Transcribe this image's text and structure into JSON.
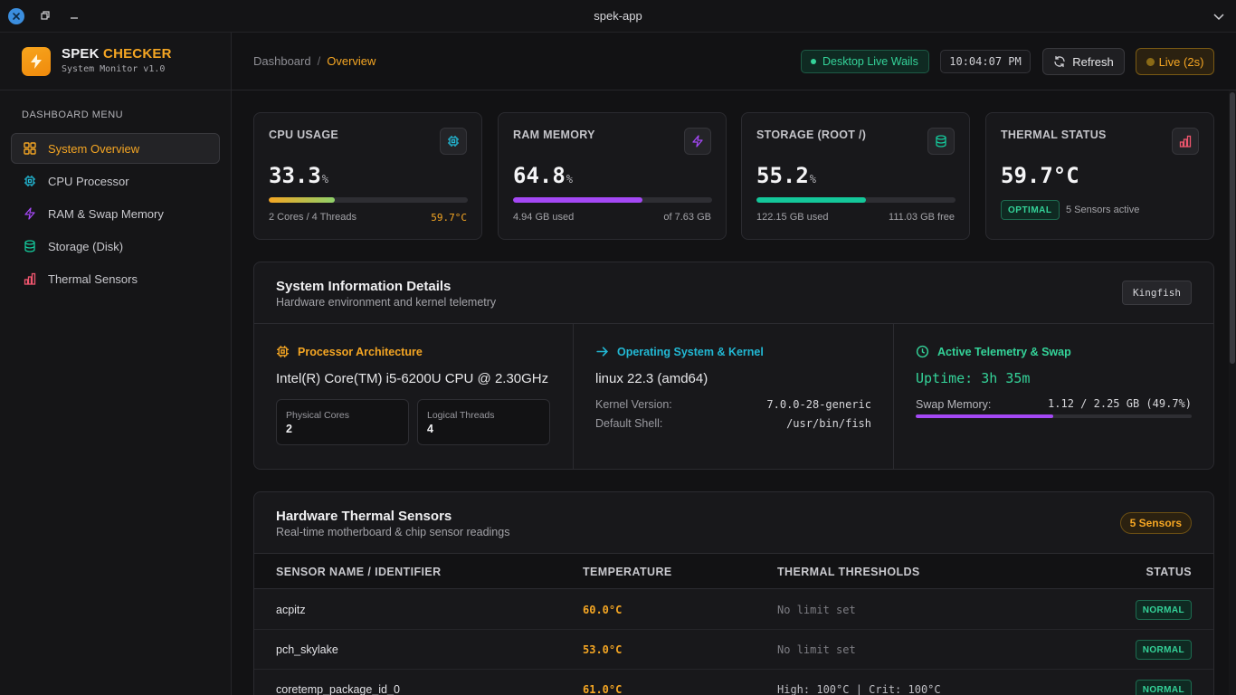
{
  "window": {
    "title": "spek-app"
  },
  "brand": {
    "name_part1": "SPEK",
    "name_part2": "CHECKER",
    "subtitle": "System Monitor v1.0"
  },
  "sidebar": {
    "menu_title": "DASHBOARD MENU",
    "items": [
      {
        "label": "System Overview",
        "icon": "grid-icon",
        "active": true
      },
      {
        "label": "CPU Processor",
        "icon": "chip-icon"
      },
      {
        "label": "RAM & Swap Memory",
        "icon": "bolt-icon"
      },
      {
        "label": "Storage (Disk)",
        "icon": "database-icon"
      },
      {
        "label": "Thermal Sensors",
        "icon": "bar-chart-icon"
      }
    ]
  },
  "header": {
    "breadcrumb": {
      "root": "Dashboard",
      "separator": "/",
      "current": "Overview"
    },
    "live_status": "Desktop Live Wails",
    "clock": "10:04:07 PM",
    "refresh_label": "Refresh",
    "live_label": "Live (2s)"
  },
  "stats": {
    "cpu": {
      "label": "CPU USAGE",
      "value": "33.3",
      "unit": "%",
      "percent": 33.3,
      "foot_left": "2 Cores / 4 Threads",
      "foot_right": "59.7°C",
      "icon": "chip-icon"
    },
    "ram": {
      "label": "RAM MEMORY",
      "value": "64.8",
      "unit": "%",
      "percent": 64.8,
      "foot_left": "4.94 GB used",
      "foot_right": "of 7.63 GB",
      "icon": "bolt-icon"
    },
    "storage": {
      "label": "STORAGE (ROOT /)",
      "value": "55.2",
      "unit": "%",
      "percent": 55.2,
      "foot_left": "122.15 GB used",
      "foot_right": "111.03 GB free",
      "icon": "database-icon"
    },
    "thermal": {
      "label": "THERMAL STATUS",
      "value": "59.7°C",
      "badge": "OPTIMAL",
      "sensors_active": "5 Sensors active",
      "icon": "bar-chart-icon"
    }
  },
  "sysinfo": {
    "title": "System Information Details",
    "subtitle": "Hardware environment and kernel telemetry",
    "tag": "Kingfish",
    "processor": {
      "title": "Processor Architecture",
      "name": "Intel(R) Core(TM) i5-6200U CPU @ 2.30GHz",
      "physical_label": "Physical Cores",
      "physical_value": "2",
      "logical_label": "Logical Threads",
      "logical_value": "4"
    },
    "os": {
      "title": "Operating System & Kernel",
      "name": "linux 22.3 (amd64)",
      "kernel_label": "Kernel Version:",
      "kernel_value": "7.0.0-28-generic",
      "shell_label": "Default Shell:",
      "shell_value": "/usr/bin/fish"
    },
    "telemetry": {
      "title": "Active Telemetry & Swap",
      "uptime": "Uptime: 3h 35m",
      "swap_label": "Swap Memory:",
      "swap_value": "1.12 / 2.25 GB (49.7%)",
      "swap_percent": 49.7
    }
  },
  "sensors": {
    "title": "Hardware Thermal Sensors",
    "subtitle": "Real-time motherboard & chip sensor readings",
    "count_badge": "5 Sensors",
    "columns": [
      "SENSOR NAME / IDENTIFIER",
      "TEMPERATURE",
      "THERMAL THRESHOLDS",
      "STATUS"
    ],
    "rows": [
      {
        "name": "acpitz",
        "temp": "60.0°C",
        "threshold": "No limit set",
        "status": "NORMAL"
      },
      {
        "name": "pch_skylake",
        "temp": "53.0°C",
        "threshold": "No limit set",
        "status": "NORMAL"
      },
      {
        "name": "coretemp_package_id_0",
        "temp": "61.0°C",
        "threshold": "High: 100°C | Crit: 100°C",
        "status": "NORMAL"
      }
    ]
  },
  "colors": {
    "accent": "#f5a623",
    "success": "#34d399",
    "ram": "#a448f5",
    "storage": "#14c79a",
    "thermal": "#f0566e",
    "cpu_icon": "#22b8d4"
  }
}
